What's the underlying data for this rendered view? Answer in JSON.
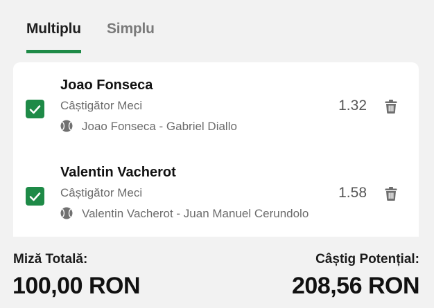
{
  "tabs": [
    {
      "label": "Multiplu",
      "active": true
    },
    {
      "label": "Simplu",
      "active": false
    }
  ],
  "bets": [
    {
      "selection": "Joao Fonseca",
      "market": "Câștigător Meci",
      "match": "Joao Fonseca - Gabriel Diallo",
      "odds": "1.32",
      "checked": true,
      "sport_icon": "tennis-ball-icon"
    },
    {
      "selection": "Valentin Vacherot",
      "market": "Câștigător Meci",
      "match": "Valentin Vacherot - Juan Manuel Cerundolo",
      "odds": "1.58",
      "checked": true,
      "sport_icon": "tennis-ball-icon"
    }
  ],
  "footer": {
    "stake_label": "Miză Totală:",
    "stake_value": "100,00 RON",
    "win_label": "Câștig Potențial:",
    "win_value": "208,56 RON"
  },
  "colors": {
    "accent": "#1e8a47",
    "background": "#f2f2f2",
    "card": "#ffffff"
  }
}
